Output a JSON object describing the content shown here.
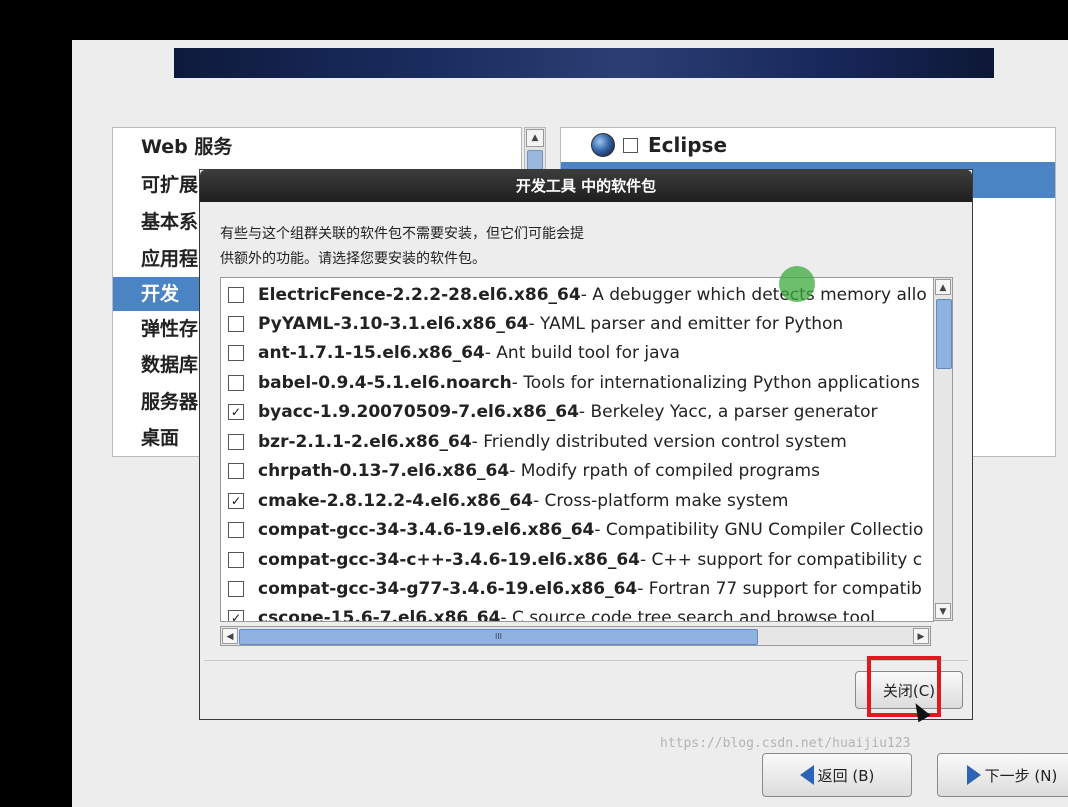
{
  "group_list": [
    "Web 服务",
    "可扩展",
    "基本系",
    "应用程",
    "开发",
    "弹性存",
    "数据库",
    "服务器",
    "桌面"
  ],
  "package_panel": {
    "label": "Eclipse"
  },
  "dialog": {
    "title": "开发工具 中的软件包",
    "description_line1": "有些与这个组群关联的软件包不需要安装，但它们可能会提",
    "description_line2": "供额外的功能。请选择您要安装的软件包。",
    "packages": [
      {
        "name": "ElectricFence-2.2.2-28.el6.x86_64",
        "desc": " - A debugger which detects memory allo",
        "checked": false
      },
      {
        "name": "PyYAML-3.10-3.1.el6.x86_64",
        "desc": " - YAML parser and emitter for Python",
        "checked": false
      },
      {
        "name": "ant-1.7.1-15.el6.x86_64",
        "desc": " - Ant build tool for java",
        "checked": false
      },
      {
        "name": "babel-0.9.4-5.1.el6.noarch",
        "desc": " - Tools for internationalizing Python applications",
        "checked": false
      },
      {
        "name": "byacc-1.9.20070509-7.el6.x86_64",
        "desc": " - Berkeley Yacc, a parser generator",
        "checked": true
      },
      {
        "name": "bzr-2.1.1-2.el6.x86_64",
        "desc": " - Friendly distributed version control system",
        "checked": false
      },
      {
        "name": "chrpath-0.13-7.el6.x86_64",
        "desc": " - Modify rpath of compiled programs",
        "checked": false
      },
      {
        "name": "cmake-2.8.12.2-4.el6.x86_64",
        "desc": " - Cross-platform make system",
        "checked": true
      },
      {
        "name": "compat-gcc-34-3.4.6-19.el6.x86_64",
        "desc": " - Compatibility GNU Compiler Collectio",
        "checked": false
      },
      {
        "name": "compat-gcc-34-c++-3.4.6-19.el6.x86_64",
        "desc": " - C++ support for compatibility c",
        "checked": false
      },
      {
        "name": "compat-gcc-34-g77-3.4.6-19.el6.x86_64",
        "desc": " - Fortran 77 support for compatib",
        "checked": false
      },
      {
        "name": "cscope-15.6-7.el6.x86_64",
        "desc": " - C source code tree search and browse tool",
        "checked": true
      }
    ],
    "close_label": "关闭(C)",
    "hscroll_grip": "III"
  },
  "nav": {
    "back_label": "返回 (B)",
    "next_label": "下一步 (N)"
  },
  "watermark": "https://blog.csdn.net/huaijiu123"
}
